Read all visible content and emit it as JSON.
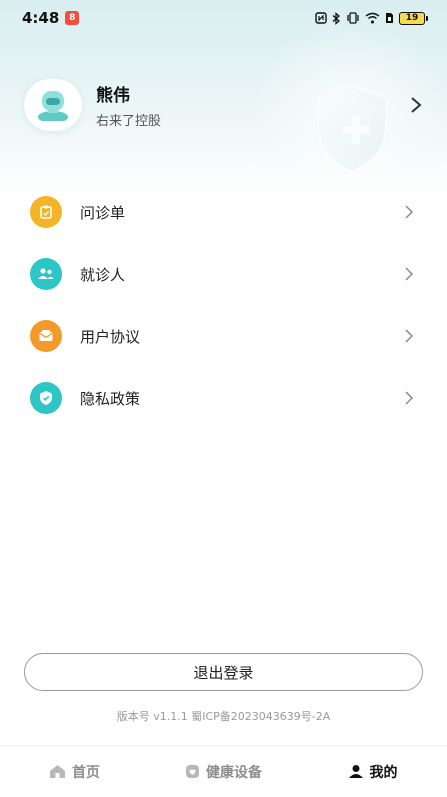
{
  "status_bar": {
    "time": "4:48",
    "notification_badge": "8",
    "battery": "19",
    "icons": [
      "nfc-icon",
      "bluetooth-icon",
      "vibrate-icon",
      "wifi-icon",
      "sim-icon",
      "battery-icon"
    ]
  },
  "profile": {
    "name": "熊伟",
    "organization": "右来了控股"
  },
  "menu": {
    "items": [
      {
        "label": "问诊单",
        "icon": "clipboard-icon",
        "color": "#f5b426"
      },
      {
        "label": "就诊人",
        "icon": "people-icon",
        "color": "#2cc6c6"
      },
      {
        "label": "用户协议",
        "icon": "envelope-icon",
        "color": "#f39a2b"
      },
      {
        "label": "隐私政策",
        "icon": "shield-check-icon",
        "color": "#2cc6c6"
      }
    ]
  },
  "logout_label": "退出登录",
  "version_text": "版本号 v1.1.1  蜀ICP备2023043639号-2A",
  "tabbar": {
    "tabs": [
      {
        "label": "首页",
        "icon": "home-icon",
        "active": false
      },
      {
        "label": "健康设备",
        "icon": "device-icon",
        "active": false
      },
      {
        "label": "我的",
        "icon": "person-icon",
        "active": true
      }
    ]
  }
}
